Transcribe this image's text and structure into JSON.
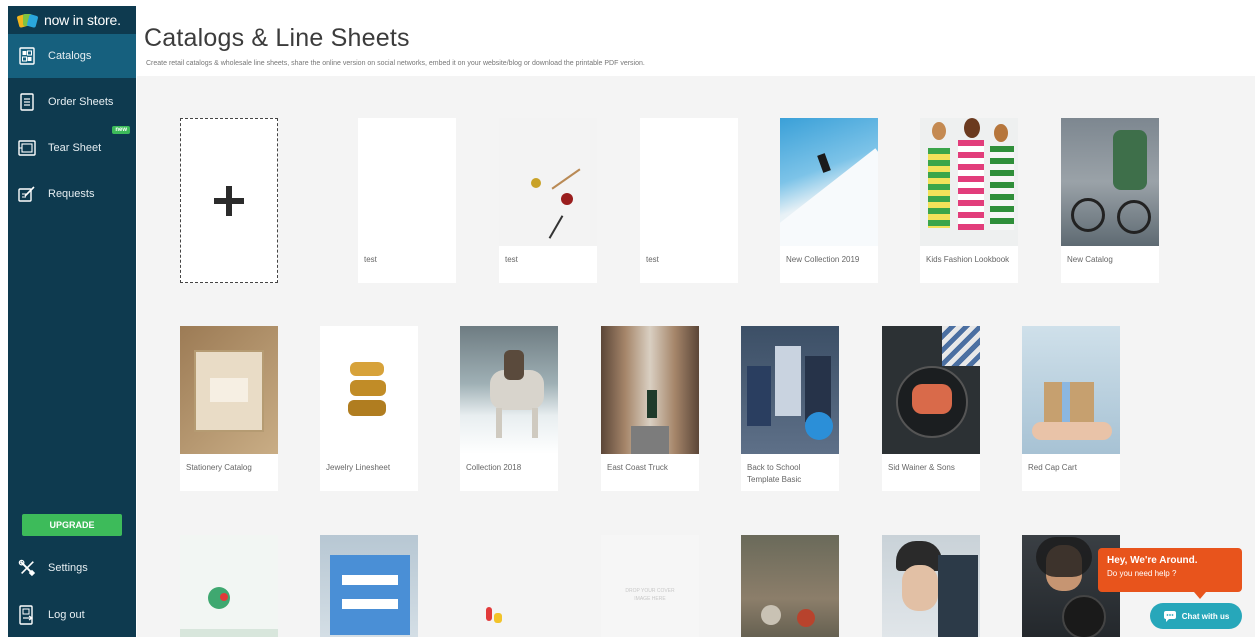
{
  "app": {
    "name": "now in store."
  },
  "sidebar": {
    "items": [
      {
        "label": "Catalogs",
        "icon": "catalog-icon",
        "active": true
      },
      {
        "label": "Order Sheets",
        "icon": "order-sheet-icon"
      },
      {
        "label": "Tear Sheet",
        "icon": "tear-sheet-icon",
        "badge": "new"
      },
      {
        "label": "Requests",
        "icon": "requests-icon"
      }
    ],
    "upgrade_label": "UPGRADE",
    "bottom_items": [
      {
        "label": "Settings",
        "icon": "tools-icon"
      },
      {
        "label": "Log out",
        "icon": "logout-icon"
      }
    ]
  },
  "header": {
    "title": "Catalogs & Line Sheets",
    "subtitle": "Create retail catalogs & wholesale line sheets, share the online version on social networks, embed it on your website/blog or download the printable PDF version."
  },
  "catalogs": {
    "row1": [
      {
        "label": "test"
      },
      {
        "label": "test"
      },
      {
        "label": "test"
      },
      {
        "label": "New Collection 2019"
      },
      {
        "label": "Kids Fashion Lookbook"
      },
      {
        "label": "New Catalog"
      }
    ],
    "row2": [
      {
        "label": "Stationery Catalog"
      },
      {
        "label": "Jewelry Linesheet"
      },
      {
        "label": "Collection 2018"
      },
      {
        "label": "East Coast Truck"
      },
      {
        "label": "Back to School Template Basic"
      },
      {
        "label": "Sid Wainer & Sons"
      },
      {
        "label": "Red Cap Cart"
      }
    ],
    "row3_placeholder_text": "DROP YOUR COVER IMAGE HERE"
  },
  "chat": {
    "title": "Hey, We're Around.",
    "subtitle": "Do you need help ?",
    "button_label": "Chat with us"
  },
  "colors": {
    "sidebar": "#0e3a4f",
    "sidebar_active": "#16607e",
    "upgrade": "#3dbb5a",
    "chat_bubble": "#e8541c",
    "chat_button": "#27a7ba"
  }
}
